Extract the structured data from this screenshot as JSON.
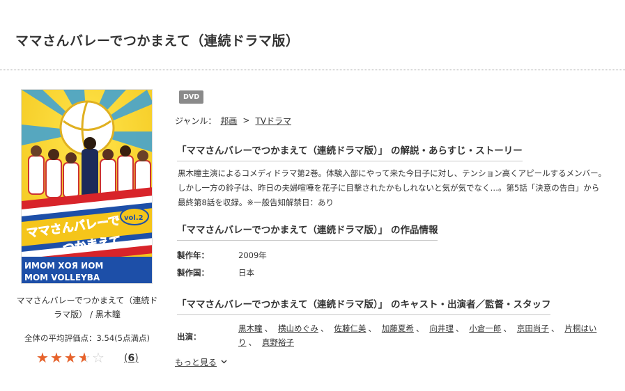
{
  "page_title": "ママさんバレーでつかまえて（連続ドラマ版）",
  "left": {
    "cover": {
      "title_art_line1": "ママさんバレーで",
      "title_art_line2": "つかまえて",
      "vol_badge": "vol.2",
      "bottom_line1": "ИМОМ ХОЯ ИОМ",
      "bottom_line2": "MOM VOLLEYBA"
    },
    "caption": "ママさんバレーでつかまえて（連続ドラマ版） / 黒木瞳",
    "avg_rating_text": "全体の平均評価点：3.54(5点満点)",
    "rating_value": 3.54,
    "rating_max": 5,
    "review_count": "6",
    "paren_open": "(",
    "paren_close": ")"
  },
  "badge": "DVD",
  "genre": {
    "label": "ジャンル：",
    "crumbs": [
      "邦画",
      "TVドラマ"
    ],
    "separator": ">"
  },
  "synopsis_section": {
    "heading": "「ママさんバレーでつかまえて（連続ドラマ版）」 の解説・あらすじ・ストーリー",
    "text": "黒木瞳主演によるコメディドラマ第2巻。体験入部にやって来た今日子に対し、テンション高くアピールするメンバー。しかし一方の鈴子は、昨日の夫婦喧嘩を花子に目撃されたかもしれないと気が気でなく…。第5話「決意の告白」から最終第8話を収録。※一般告知解禁日：あり"
  },
  "info_section": {
    "heading": "「ママさんバレーでつかまえて（連続ドラマ版）」 の作品情報",
    "rows": [
      {
        "label": "製作年：",
        "value": "2009年"
      },
      {
        "label": "製作国：",
        "value": "日本"
      }
    ]
  },
  "cast_section": {
    "heading": "「ママさんバレーでつかまえて（連続ドラマ版）」 のキャスト・出演者／監督・スタッフ",
    "cast_label": "出演：",
    "cast": [
      "黒木瞳",
      "横山めぐみ",
      "佐藤仁美",
      "加藤夏希",
      "向井理",
      "小倉一郎",
      "京田尚子",
      "片桐はいり",
      "真野裕子"
    ],
    "comma": "、",
    "more_label": "もっと見る",
    "more_icon": "chevron-down-icon"
  },
  "colors": {
    "star_fill": "#e8622a",
    "star_empty": "#d0d0d0",
    "badge_bg": "#8a8a8a"
  }
}
